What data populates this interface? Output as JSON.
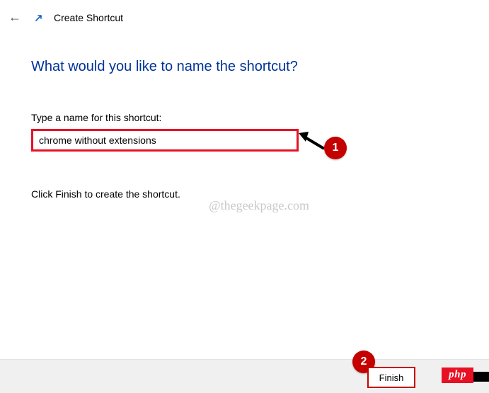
{
  "titlebar": {
    "title": "Create Shortcut"
  },
  "heading": "What would you like to name the shortcut?",
  "label": "Type a name for this shortcut:",
  "input_value": "chrome without extensions",
  "instruction": "Click Finish to create the shortcut.",
  "watermark": "@thegeekpage.com",
  "callouts": {
    "badge1": "1",
    "badge2": "2"
  },
  "buttons": {
    "finish": "Finish"
  },
  "overlay": {
    "php": "php"
  }
}
